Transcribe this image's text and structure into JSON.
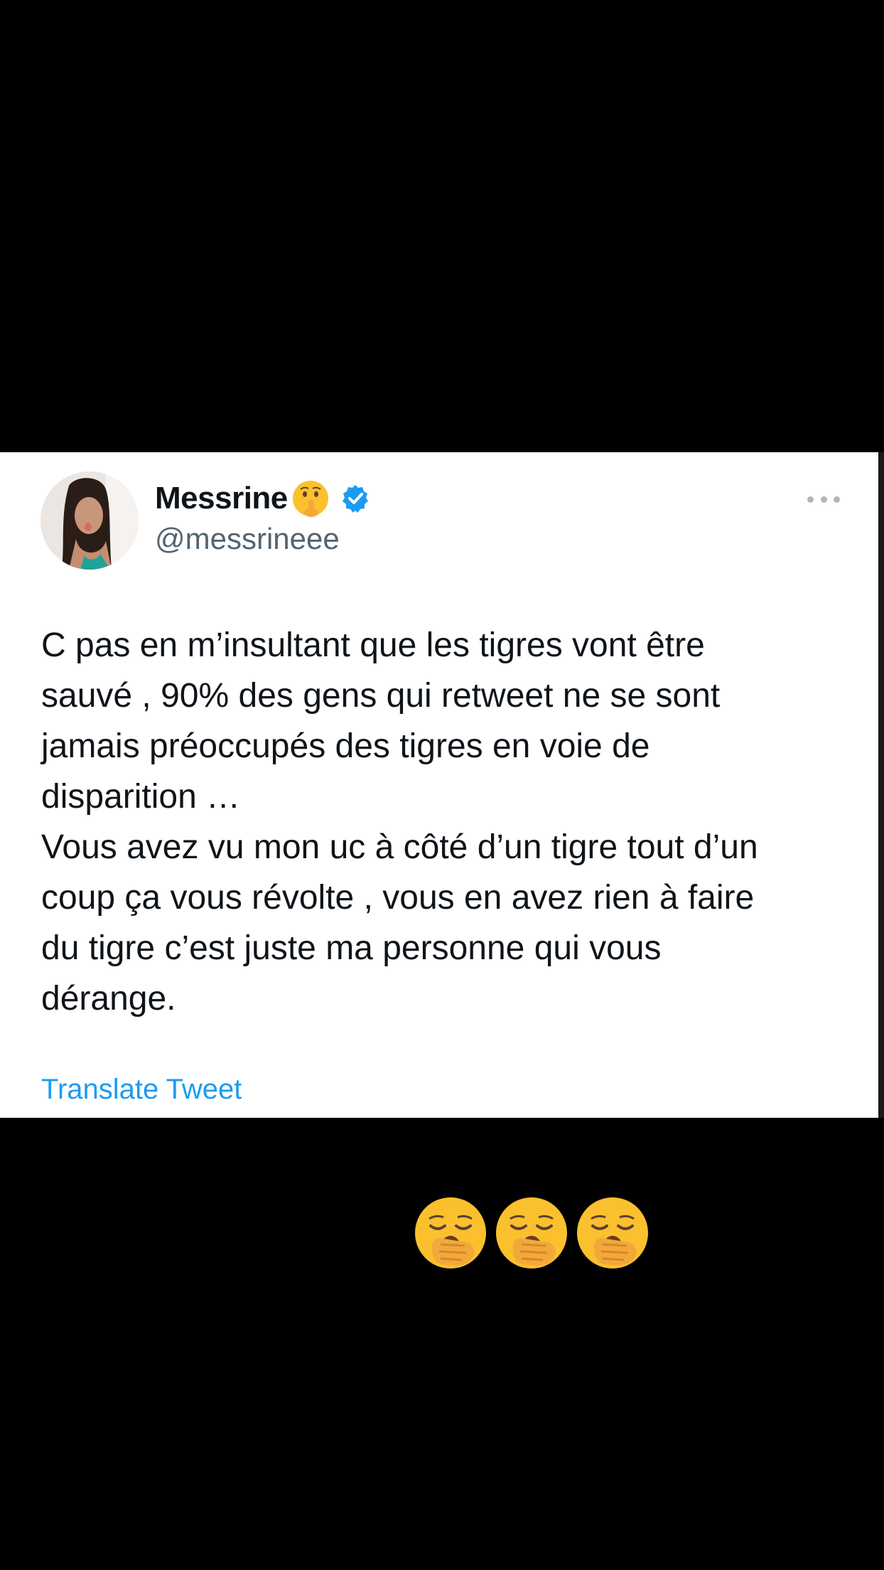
{
  "tweet": {
    "author": {
      "display_name": "Messrine",
      "name_emoji": "shushing-face-emoji",
      "verified": true,
      "handle": "@messrineee",
      "avatar": "profile-photo"
    },
    "more_icon": "more-horizontal-icon",
    "text": "C pas en m’insultant que les tigres vont être\nsauvé , 90% des gens qui retweet ne se sont\njamais préoccupés des tigres en voie de\ndisparition …\nVous avez vu mon uc à côté d’un tigre tout d’un\ncoup ça vous révolte , vous en avez rien à faire\ndu tigre c’est juste ma personne qui vous\ndérange.",
    "translate_label": "Translate Tweet"
  },
  "caption": {
    "emojis": [
      "yawning-face-emoji",
      "yawning-face-emoji",
      "yawning-face-emoji"
    ]
  },
  "colors": {
    "background": "#000000",
    "card": "#ffffff",
    "text_primary": "#0f1419",
    "text_secondary": "#536471",
    "link": "#1d9bf0",
    "verified": "#1d9bf0",
    "emoji_yellow": "#fbc02d"
  }
}
